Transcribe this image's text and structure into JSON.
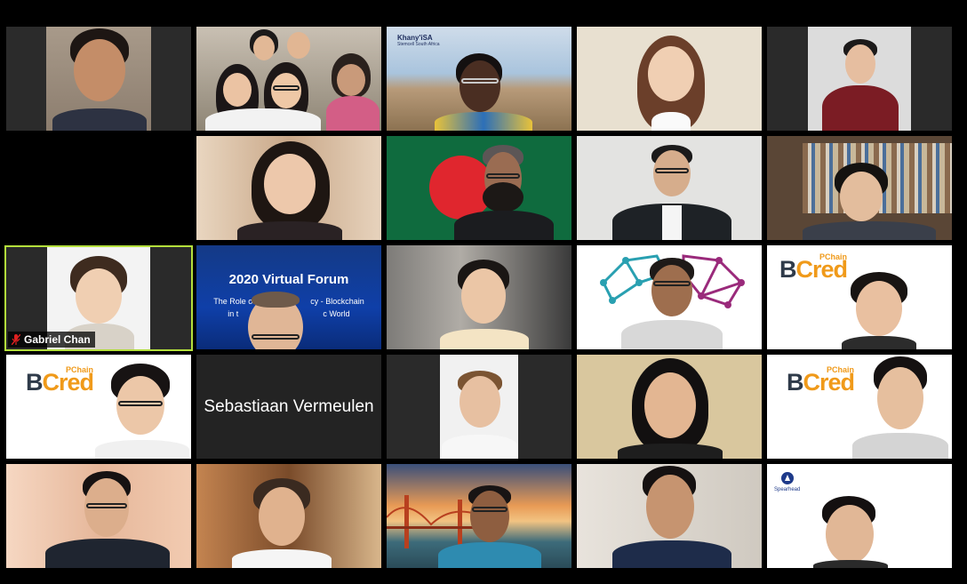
{
  "meeting": {
    "view": "gallery"
  },
  "tiles": {
    "active_speaker_name": "Gabriel Chan",
    "name_only_tile": "Sebastiaan Vermeulen",
    "forum_title": "2020 Virtual Forum",
    "forum_subtitle_line1": "The Role o",
    "forum_subtitle_line1b": "cy - Blockchain",
    "forum_subtitle_line2": "in t",
    "forum_subtitle_line2b": "c World",
    "bcred_b": "B",
    "bcred_cred": "Cred",
    "bcred_pchain": "PChain",
    "khanyisa_logo": "Khany'iSA",
    "khanyisa_sub": "Stemcell South Africa",
    "spearhead_logo": "Spearhead"
  },
  "colors": {
    "active_border": "#b4e03c",
    "muted_mic": "#e02020",
    "bcred_orange": "#f09a1a",
    "bcred_dark": "#2f3b4a",
    "forum_blue": "#0f3fa8"
  }
}
